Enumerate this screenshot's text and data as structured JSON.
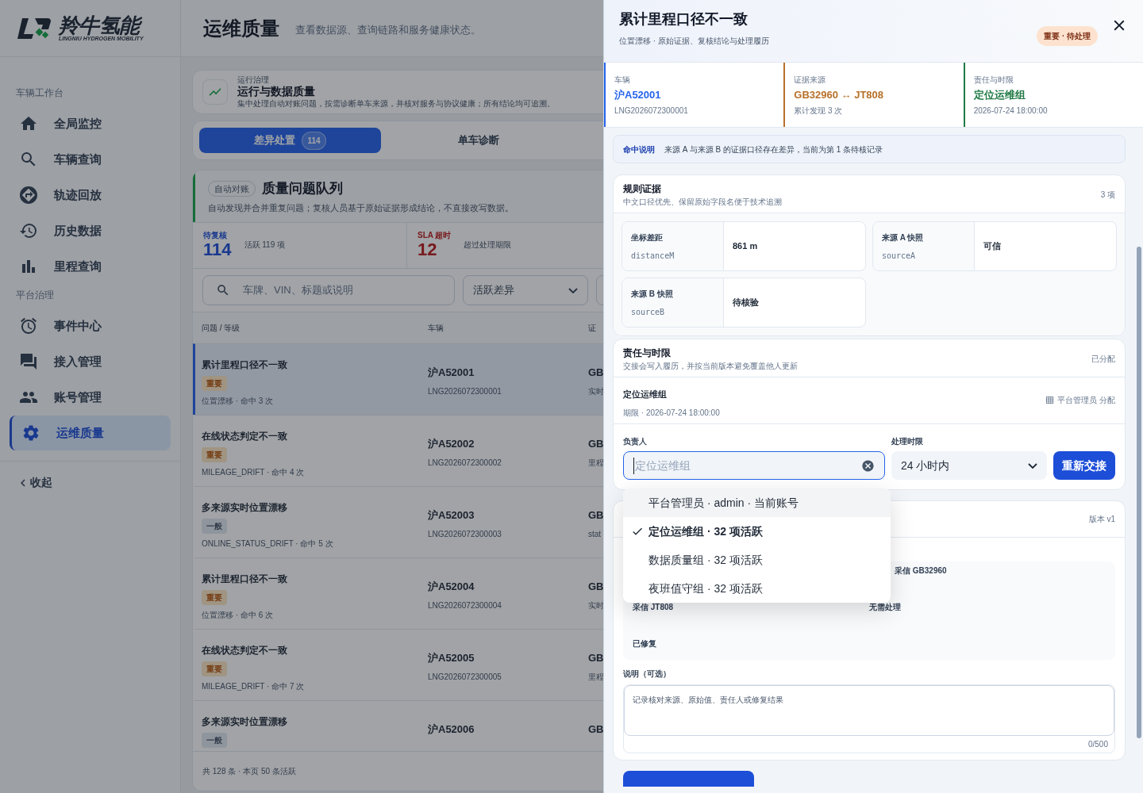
{
  "sidebar": {
    "logo": {
      "name": "羚牛氢能",
      "tagline": "LINGNIU HYDROGEN MOBILITY"
    },
    "groups": [
      {
        "label": "车辆工作台",
        "items": [
          {
            "label": "全局监控",
            "selected": false
          },
          {
            "label": "车辆查询",
            "selected": false
          },
          {
            "label": "轨迹回放",
            "selected": false
          },
          {
            "label": "历史数据",
            "selected": false
          },
          {
            "label": "里程查询",
            "selected": false
          }
        ]
      },
      {
        "label": "平台治理",
        "items": [
          {
            "label": "事件中心",
            "selected": false
          },
          {
            "label": "接入管理",
            "selected": false
          },
          {
            "label": "账号管理",
            "selected": false
          },
          {
            "label": "运维质量",
            "selected": true
          }
        ]
      }
    ],
    "collapse": "收起"
  },
  "header": {
    "title": "运维质量",
    "subtitle": "查看数据源、查询链路和服务健康状态。"
  },
  "banner": {
    "eyebrow": "运行治理",
    "title": "运行与数据质量",
    "description": "集中处理自动对账问题，按需诊断单车来源，并核对服务与协议健康；所有结论均可追溯。"
  },
  "tabs": [
    {
      "label": "差异处置",
      "badge": "114",
      "selected": true
    },
    {
      "label": "单车诊断",
      "selected": false
    }
  ],
  "queue": {
    "tag": "自动对账",
    "title": "质量问题队列",
    "description": "自动发现并合并重复问题；复核人员基于原始证据形成结论，不直接改写数据。",
    "stats": [
      {
        "label": "待复核",
        "value": "114",
        "note": "活跃 119 项",
        "kind": "pending"
      },
      {
        "label": "SLA 超时",
        "value": "12",
        "note": "超过处理期限",
        "kind": "overdue"
      }
    ],
    "search": {
      "placeholder": "车牌、VIN、标题或说明"
    },
    "filter": "活跃差异",
    "columns": [
      "问题 / 等级",
      "车辆",
      "证"
    ],
    "rows": [
      {
        "title": "累计里程口径不一致",
        "level": {
          "text": "重要",
          "kind": "major"
        },
        "meta": "位置漂移 · 命中 3 次",
        "plate": "沪A52001",
        "vin": "LNG2026072300001",
        "column_3": "GB",
        "column_3_sub": "实时",
        "selected": true
      },
      {
        "title": "在线状态判定不一致",
        "level": {
          "text": "重要",
          "kind": "major"
        },
        "meta": "MILEAGE_DRIFT · 命中 4 次",
        "plate": "沪A52002",
        "vin": "LNG2026072300002",
        "column_3": "GB",
        "column_3_sub": "里程",
        "selected": false
      },
      {
        "title": "多来源实时位置漂移",
        "level": {
          "text": "一般",
          "kind": "normal"
        },
        "meta": "ONLINE_STATUS_DRIFT · 命中 5 次",
        "plate": "沪A52003",
        "vin": "LNG2026072300003",
        "column_3": "GB",
        "column_3_sub": "stat",
        "selected": false
      },
      {
        "title": "累计里程口径不一致",
        "level": {
          "text": "重要",
          "kind": "major"
        },
        "meta": "位置漂移 · 命中 6 次",
        "plate": "沪A52004",
        "vin": "LNG2026072300004",
        "column_3": "GB",
        "column_3_sub": "实时",
        "selected": false
      },
      {
        "title": "在线状态判定不一致",
        "level": {
          "text": "重要",
          "kind": "major"
        },
        "meta": "MILEAGE_DRIFT · 命中 7 次",
        "plate": "沪A52005",
        "vin": "LNG2026072300005",
        "column_3": "GB",
        "column_3_sub": "里程",
        "selected": false
      },
      {
        "title": "多来源实时位置漂移",
        "level": {
          "text": "一般",
          "kind": "normal"
        },
        "plate": "沪A52006",
        "column_3": "GB",
        "selected": false
      }
    ],
    "footer": "共 128 条 · 本页 50 条活跃"
  },
  "drawer": {
    "title": "累计里程口径不一致",
    "subtitle": "位置漂移 · 原始证据、复核结论与处理履历",
    "status": "重要 · 待处理",
    "summary": [
      {
        "label": "车辆",
        "value": "沪A52001",
        "sub": "LNG2026072300001",
        "color": "#2563eb"
      },
      {
        "label": "证据来源",
        "value": "GB32960 ↔ JT808",
        "sub": "累计发现 3 次",
        "color": "#b7702a"
      },
      {
        "label": "责任与时限",
        "value": "定位运维组",
        "sub": "2026-07-24 18:00:00",
        "color": "#1f7a45"
      }
    ],
    "hit": {
      "label": "命中说明",
      "text": "来源 A 与来源 B 的证据口径存在差异，当前为第 1 条待核记录"
    },
    "evidence": {
      "title": "规则证据",
      "description": "中文口径优先、保留原始字段名便于技术追溯",
      "count": "3 项",
      "fields": [
        {
          "label": "坐标差距",
          "key": "distanceM",
          "value": "861 m"
        },
        {
          "label": "来源 A 快照",
          "key": "sourceA",
          "value": "可信"
        },
        {
          "label": "来源 B 快照",
          "key": "sourceB",
          "value": "待核验"
        }
      ]
    },
    "responsibility": {
      "title": "责任与时限",
      "description": "交接会写入履历，并按当前版本避免覆盖他人更新",
      "status": "已分配",
      "current": {
        "name": "定位运维组",
        "deadline": "期限 · 2026-07-24 18:00:00",
        "assigned_by": "平台管理员 分配"
      },
      "assignee": {
        "label": "负责人",
        "placeholder": "定位运维组"
      },
      "deadline": {
        "label": "处理时限",
        "value": "24 小时内"
      },
      "button": "重新交接"
    },
    "assignee_options": [
      {
        "label": "平台管理员 · admin · 当前账号",
        "selected": false,
        "highlighted": true
      },
      {
        "label": "定位运维组 · 32 项活跃",
        "selected": true,
        "highlighted": false
      },
      {
        "label": "数据质量组 · 32 项活跃",
        "selected": false,
        "highlighted": false
      },
      {
        "label": "夜班值守组 · 32 项活跃",
        "selected": false,
        "highlighted": false
      }
    ],
    "conclusion": {
      "version": "版本 v1",
      "options": [
        "采信 GB32960",
        "采信 JT808",
        "无需处理",
        "已修复"
      ],
      "note_label": "说明（可选）",
      "note_placeholder": "记录核对来源、原始值、责任人或修复结果",
      "counter": "0/500"
    }
  }
}
